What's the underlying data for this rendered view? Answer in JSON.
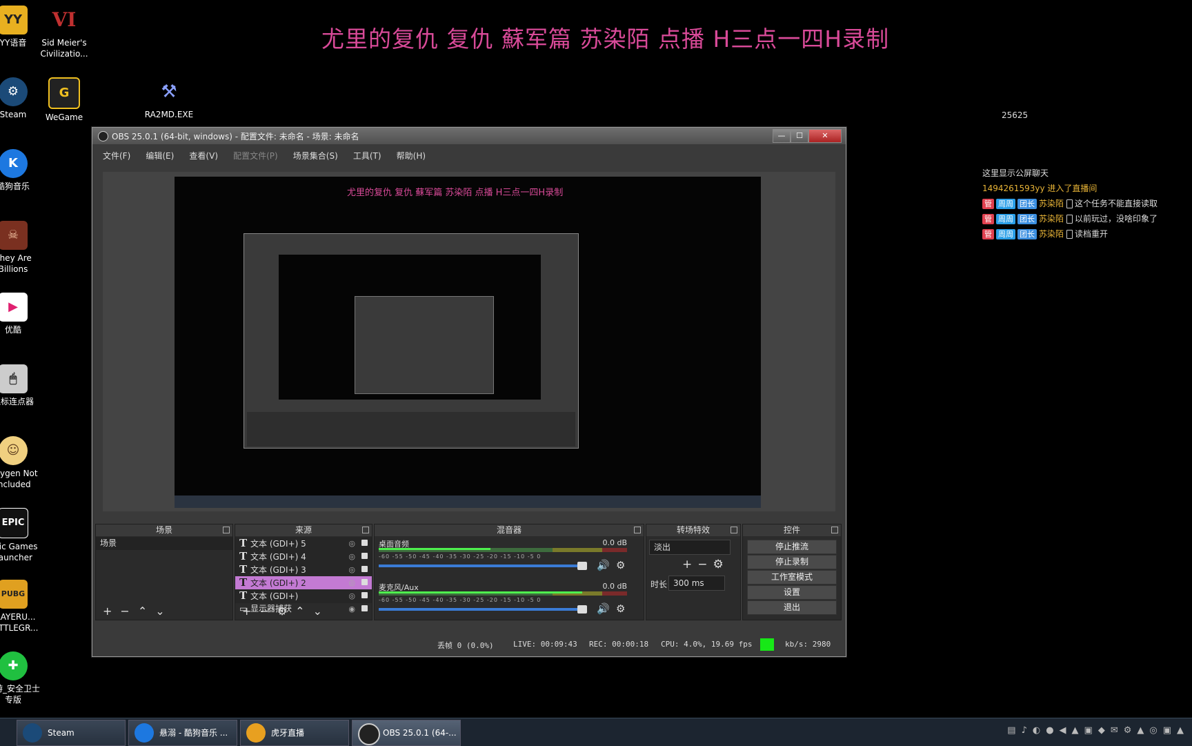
{
  "overlay": {
    "title": "尤里的复仇 复仇 蘇军篇  苏染陌 点播  H三点一四H录制",
    "viewer_count": "25625"
  },
  "chat": {
    "header": "这里显示公屏聊天",
    "join_message": "1494261593yy 进入了直播间",
    "badge_guan": "管",
    "badge_zhouzhou": "周周",
    "badge_tuanzhang": "团长",
    "messages": [
      {
        "user": "苏染陌",
        "text": "这个任务不能直接读取"
      },
      {
        "user": "苏染陌",
        "text": "以前玩过，没啥印象了"
      },
      {
        "user": "苏染陌",
        "text": "读档重开"
      }
    ]
  },
  "desktop_icons": [
    {
      "label": "YY语音"
    },
    {
      "label": "Sid Meier's Civilizatio..."
    },
    {
      "label": "Steam"
    },
    {
      "label": "WeGame"
    },
    {
      "label": "RA2MD.EXE"
    },
    {
      "label": "酷狗音乐"
    },
    {
      "label": "They Are Billions"
    },
    {
      "label": "优酷"
    },
    {
      "label": "鼠标连点器"
    },
    {
      "label": "Oxygen Not Included"
    },
    {
      "label": "Epic Games Launcher"
    },
    {
      "label": "PLAYERU... BATTLEGR..."
    },
    {
      "label": "网游_安全卫士专版"
    }
  ],
  "obs": {
    "window_title": "OBS 25.0.1 (64-bit, windows) - 配置文件: 未命名 - 场景: 未命名",
    "menu": [
      "文件(F)",
      "编辑(E)",
      "查看(V)",
      "配置文件(P)",
      "场景集合(S)",
      "工具(T)",
      "帮助(H)"
    ],
    "docks": {
      "scenes": {
        "title": "场景",
        "items": [
          "场景"
        ]
      },
      "sources": {
        "title": "来源",
        "items": [
          "文本 (GDI+) 5",
          "文本 (GDI+) 4",
          "文本 (GDI+) 3",
          "文本 (GDI+) 2",
          "文本 (GDI+)",
          "显示器捕获"
        ]
      },
      "mixer": {
        "title": "混音器",
        "tracks": [
          {
            "name": "桌面音频",
            "db": "0.0 dB",
            "level": 0.45
          },
          {
            "name": "麦克风/Aux",
            "db": "0.0 dB",
            "level": 0.82
          }
        ],
        "scale": "-60  -55  -50  -45  -40  -35  -30  -25  -20  -15  -10  -5  0"
      },
      "transitions": {
        "title": "转场特效",
        "current": "淡出",
        "duration_label": "时长",
        "duration_value": "300 ms"
      },
      "controls": {
        "title": "控件",
        "buttons": [
          "停止推流",
          "停止录制",
          "工作室模式",
          "设置",
          "退出"
        ]
      }
    },
    "status": {
      "dropped": "丢帧 0 (0.0%)",
      "live": "LIVE: 00:09:43",
      "rec": "REC: 00:00:18",
      "cpu": "CPU: 4.0%, 19.69 fps",
      "kbps": "kb/s: 2980"
    }
  },
  "taskbar": {
    "items": [
      "Steam",
      "悬溺 - 酷狗音乐 ...",
      "虎牙直播",
      "OBS 25.0.1 (64-..."
    ]
  }
}
